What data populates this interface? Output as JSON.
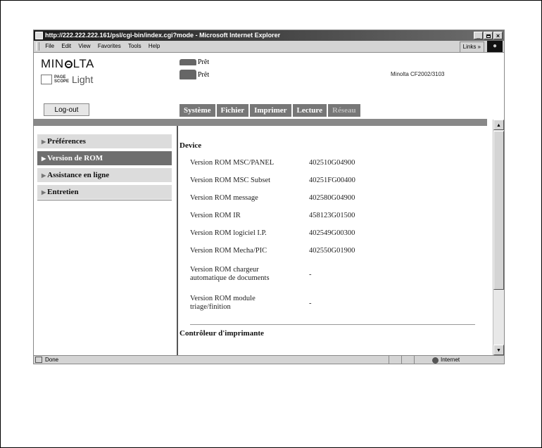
{
  "window": {
    "title": "http://222.222.222.161/psl/cgi-bin/index.cgi?mode - Microsoft Internet Explorer",
    "controls": [
      "_",
      "×"
    ]
  },
  "menubar": {
    "items": [
      "File",
      "Edit",
      "View",
      "Favorites",
      "Tools",
      "Help"
    ],
    "links_label": "Links »"
  },
  "header": {
    "logo_parts": [
      "MIN",
      "LTA"
    ],
    "pagescope_box": "PAGE SCOPE",
    "pagescope_label": "Light",
    "status_lines": [
      "Prêt",
      "Prêt"
    ],
    "model": "Minolta CF2002/3103"
  },
  "logout_label": "Log-out",
  "tabs": [
    {
      "label": "Système",
      "enabled": true
    },
    {
      "label": "Fichier",
      "enabled": true
    },
    {
      "label": "Imprimer",
      "enabled": true
    },
    {
      "label": "Lecture",
      "enabled": true
    },
    {
      "label": "Réseau",
      "enabled": false
    }
  ],
  "sidebar": {
    "items": [
      {
        "label": "Préférences",
        "active": false
      },
      {
        "label": "Version de ROM",
        "active": true
      },
      {
        "label": "Assistance en ligne",
        "active": false
      },
      {
        "label": "Entretien",
        "active": false
      }
    ],
    "arrow": "▶"
  },
  "main": {
    "section1_title": "Device",
    "rows": [
      {
        "label": "Version ROM MSC/PANEL",
        "value": "402510G04900"
      },
      {
        "label": "Version ROM MSC Subset",
        "value": "40251FG00400"
      },
      {
        "label": "Version ROM message",
        "value": "402580G04900"
      },
      {
        "label": "Version ROM IR",
        "value": "458123G01500"
      },
      {
        "label": "Version ROM logiciel I.P.",
        "value": "402549G00300"
      },
      {
        "label": "Version ROM Mecha/PIC",
        "value": "402550G01900"
      },
      {
        "label": "Version ROM chargeur automatique de documents",
        "value": "-"
      },
      {
        "label": "Version ROM module triage/finition",
        "value": "-"
      }
    ],
    "section2_title": "Contrôleur d'imprimante"
  },
  "statusbar": {
    "text": "Done",
    "zone": "Internet"
  },
  "scroll_glyphs": {
    "up": "▲",
    "down": "▼"
  }
}
